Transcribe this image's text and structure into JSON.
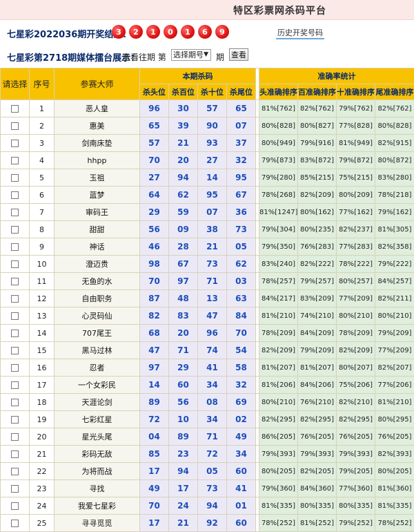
{
  "header": {
    "title": "特区彩票网杀码平台"
  },
  "result": {
    "label": "七星彩2022036期开奖结果：",
    "balls": [
      "3",
      "2",
      "1",
      "0",
      "1",
      "6",
      "9"
    ],
    "history_link": "历史开奖号码"
  },
  "show": {
    "label": "七星彩第2718期媒体擂台展示：",
    "view_label": "查看往期 第",
    "select_value": "选择期号",
    "period_label": "期",
    "query_button": "查看"
  },
  "table": {
    "col_select": "请选择",
    "col_index": "序号",
    "col_master": "参赛大师",
    "group_kill": "本期杀码",
    "group_stats": "准确率统计",
    "kill_cols": [
      "杀头位",
      "杀百位",
      "杀十位",
      "杀尾位"
    ],
    "stat_cols": [
      "头准确排序",
      "百准确排序",
      "十准确排序",
      "尾准确排序"
    ],
    "rows": [
      {
        "i": "1",
        "name": "恶人皇",
        "k": [
          "96",
          "30",
          "57",
          "65"
        ],
        "s": [
          "81%[762]",
          "82%[762]",
          "79%[762]",
          "82%[762]"
        ]
      },
      {
        "i": "2",
        "name": "惠美",
        "k": [
          "65",
          "39",
          "90",
          "07"
        ],
        "s": [
          "80%[828]",
          "80%[827]",
          "77%[828]",
          "80%[828]"
        ]
      },
      {
        "i": "3",
        "name": "剑南床垫",
        "k": [
          "57",
          "21",
          "93",
          "37"
        ],
        "s": [
          "80%[949]",
          "79%[916]",
          "81%[949]",
          "82%[915]"
        ]
      },
      {
        "i": "4",
        "name": "hhpp",
        "k": [
          "70",
          "20",
          "27",
          "32"
        ],
        "s": [
          "79%[873]",
          "83%[872]",
          "79%[872]",
          "80%[872]"
        ]
      },
      {
        "i": "5",
        "name": "玉祖",
        "k": [
          "27",
          "94",
          "14",
          "95"
        ],
        "s": [
          "79%[280]",
          "85%[215]",
          "75%[215]",
          "83%[280]"
        ]
      },
      {
        "i": "6",
        "name": "蓝梦",
        "k": [
          "64",
          "62",
          "95",
          "67"
        ],
        "s": [
          "78%[268]",
          "82%[209]",
          "80%[209]",
          "78%[218]"
        ]
      },
      {
        "i": "7",
        "name": "审码王",
        "k": [
          "29",
          "59",
          "07",
          "36"
        ],
        "s": [
          "81%[1247]",
          "80%[162]",
          "77%[162]",
          "79%[162]"
        ]
      },
      {
        "i": "8",
        "name": "甜甜",
        "k": [
          "56",
          "09",
          "38",
          "73"
        ],
        "s": [
          "79%[304]",
          "80%[235]",
          "82%[237]",
          "81%[305]"
        ]
      },
      {
        "i": "9",
        "name": "神话",
        "k": [
          "46",
          "28",
          "21",
          "05"
        ],
        "s": [
          "79%[350]",
          "76%[283]",
          "77%[283]",
          "82%[358]"
        ]
      },
      {
        "i": "10",
        "name": "澄迈贵",
        "k": [
          "98",
          "67",
          "73",
          "62"
        ],
        "s": [
          "83%[240]",
          "82%[222]",
          "78%[222]",
          "79%[222]"
        ]
      },
      {
        "i": "11",
        "name": "无鱼的水",
        "k": [
          "70",
          "97",
          "71",
          "03"
        ],
        "s": [
          "78%[257]",
          "79%[257]",
          "80%[257]",
          "84%[257]"
        ]
      },
      {
        "i": "12",
        "name": "自由职务",
        "k": [
          "87",
          "48",
          "13",
          "63"
        ],
        "s": [
          "84%[217]",
          "83%[209]",
          "77%[209]",
          "82%[211]"
        ]
      },
      {
        "i": "13",
        "name": "心灵码仙",
        "k": [
          "82",
          "83",
          "47",
          "84"
        ],
        "s": [
          "81%[210]",
          "74%[210]",
          "80%[210]",
          "80%[210]"
        ]
      },
      {
        "i": "14",
        "name": "707尾王",
        "k": [
          "68",
          "20",
          "96",
          "70"
        ],
        "s": [
          "78%[209]",
          "84%[209]",
          "78%[209]",
          "79%[209]"
        ]
      },
      {
        "i": "15",
        "name": "黑马过林",
        "k": [
          "47",
          "71",
          "74",
          "54"
        ],
        "s": [
          "82%[209]",
          "79%[209]",
          "82%[209]",
          "77%[209]"
        ]
      },
      {
        "i": "16",
        "name": "忍者",
        "k": [
          "97",
          "29",
          "41",
          "58"
        ],
        "s": [
          "81%[207]",
          "81%[207]",
          "80%[207]",
          "82%[207]"
        ]
      },
      {
        "i": "17",
        "name": "一个女彩民",
        "k": [
          "14",
          "60",
          "34",
          "32"
        ],
        "s": [
          "81%[206]",
          "84%[206]",
          "75%[206]",
          "77%[206]"
        ]
      },
      {
        "i": "18",
        "name": "天涯论剑",
        "k": [
          "89",
          "56",
          "08",
          "69"
        ],
        "s": [
          "80%[210]",
          "76%[210]",
          "82%[210]",
          "81%[210]"
        ]
      },
      {
        "i": "19",
        "name": "七彩红星",
        "k": [
          "72",
          "10",
          "34",
          "02"
        ],
        "s": [
          "82%[295]",
          "82%[295]",
          "82%[295]",
          "80%[295]"
        ]
      },
      {
        "i": "20",
        "name": "星光头尾",
        "k": [
          "04",
          "89",
          "71",
          "49"
        ],
        "s": [
          "86%[205]",
          "76%[205]",
          "76%[205]",
          "76%[205]"
        ]
      },
      {
        "i": "21",
        "name": "彩码无敌",
        "k": [
          "85",
          "23",
          "72",
          "34"
        ],
        "s": [
          "79%[393]",
          "79%[393]",
          "79%[393]",
          "82%[393]"
        ]
      },
      {
        "i": "22",
        "name": "为将而战",
        "k": [
          "17",
          "94",
          "05",
          "60"
        ],
        "s": [
          "80%[205]",
          "82%[205]",
          "79%[205]",
          "80%[205]"
        ]
      },
      {
        "i": "23",
        "name": "寻找",
        "k": [
          "49",
          "17",
          "73",
          "41"
        ],
        "s": [
          "79%[360]",
          "84%[360]",
          "77%[360]",
          "81%[360]"
        ]
      },
      {
        "i": "24",
        "name": "我爱七星彩",
        "k": [
          "70",
          "24",
          "94",
          "01"
        ],
        "s": [
          "81%[335]",
          "80%[335]",
          "80%[335]",
          "81%[335]"
        ]
      },
      {
        "i": "25",
        "name": "寻寻觅觅",
        "k": [
          "17",
          "21",
          "92",
          "60"
        ],
        "s": [
          "78%[252]",
          "81%[252]",
          "79%[252]",
          "78%[252]"
        ]
      }
    ]
  }
}
